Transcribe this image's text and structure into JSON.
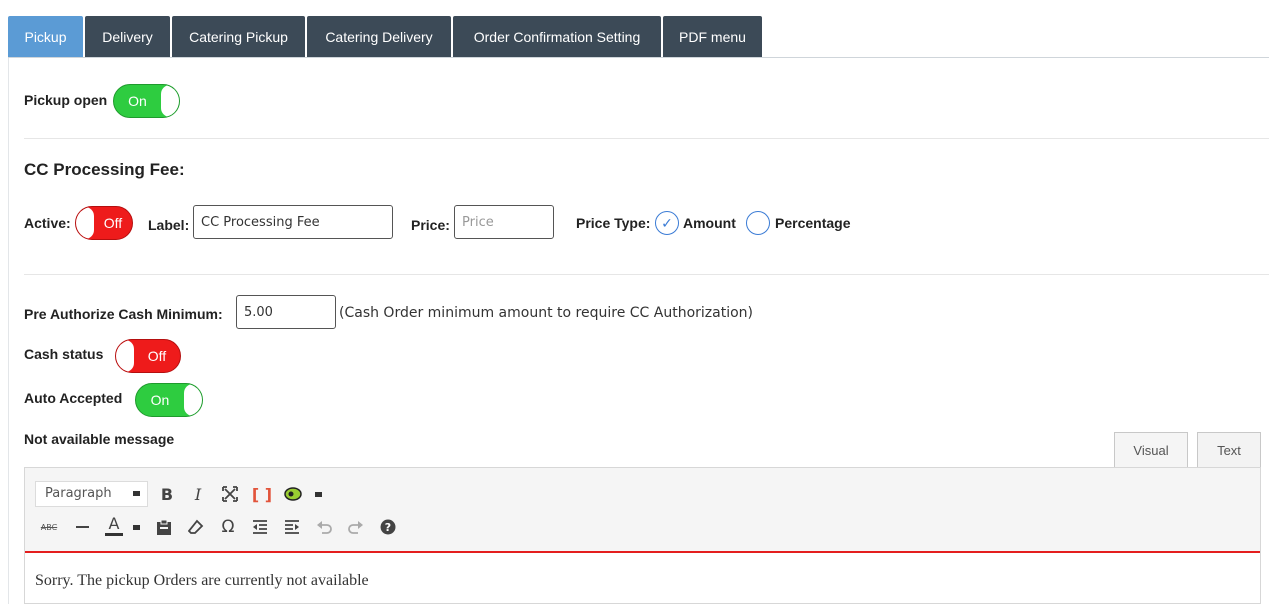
{
  "tabs": [
    {
      "label": "Pickup",
      "active": true
    },
    {
      "label": "Delivery",
      "active": false
    },
    {
      "label": "Catering Pickup",
      "active": false
    },
    {
      "label": "Catering Delivery",
      "active": false
    },
    {
      "label": "Order Confirmation Setting",
      "active": false
    },
    {
      "label": "PDF menu",
      "active": false
    }
  ],
  "pickup_open": {
    "label": "Pickup open",
    "state": "On"
  },
  "cc_fee": {
    "heading": "CC Processing Fee:",
    "active_label": "Active:",
    "active_state": "Off",
    "label_label": "Label:",
    "label_value": "CC Processing Fee",
    "price_label": "Price:",
    "price_placeholder": "Price",
    "price_type_label": "Price Type:",
    "option_amount": "Amount",
    "option_percentage": "Percentage",
    "selected": "Amount"
  },
  "pre_auth": {
    "label": "Pre Authorize Cash Minimum:",
    "value": "5.00",
    "note": "(Cash Order minimum amount to require CC Authorization)"
  },
  "cash_status": {
    "label": "Cash status",
    "state": "Off"
  },
  "auto_accepted": {
    "label": "Auto Accepted",
    "state": "On"
  },
  "not_available": {
    "label": "Not available message",
    "editor_tabs": {
      "visual": "Visual",
      "text": "Text"
    },
    "format_select": "Paragraph",
    "content": "Sorry. The pickup Orders are currently not available"
  },
  "colors": {
    "tab_active": "#5b9bd5",
    "tab_inactive": "#3c4a57",
    "toggle_on": "#2ecc40",
    "toggle_off": "#ee1b1b"
  }
}
